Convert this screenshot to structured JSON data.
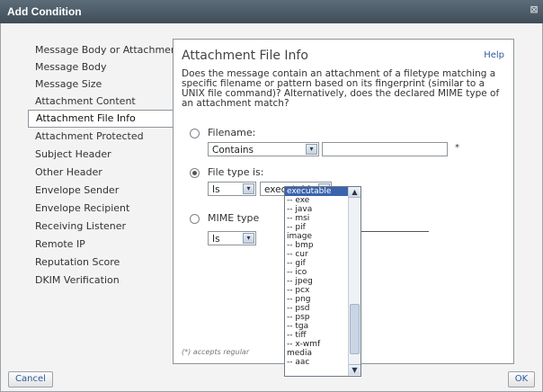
{
  "window": {
    "title": "Add Condition",
    "close_glyph": "⊠"
  },
  "sidebar": {
    "items": [
      {
        "label": "Message Body or Attachment"
      },
      {
        "label": "Message Body"
      },
      {
        "label": "Message Size"
      },
      {
        "label": "Attachment Content"
      },
      {
        "label": "Attachment File Info",
        "active": true
      },
      {
        "label": "Attachment Protected"
      },
      {
        "label": "Subject Header"
      },
      {
        "label": "Other Header"
      },
      {
        "label": "Envelope Sender"
      },
      {
        "label": "Envelope Recipient"
      },
      {
        "label": "Receiving Listener"
      },
      {
        "label": "Remote IP"
      },
      {
        "label": "Reputation Score"
      },
      {
        "label": "DKIM Verification"
      }
    ]
  },
  "panel": {
    "title": "Attachment File Info",
    "help": "Help",
    "description": "Does the message contain an attachment of a filetype matching a specific filename or pattern based on its fingerprint (similar to a UNIX file command)? Alternatively, does the declared MIME type of an attachment match?",
    "filename": {
      "label": "Filename:",
      "operator": "Contains",
      "value": "",
      "required_mark": "*"
    },
    "filetype": {
      "label": "File type is:",
      "operator": "Is",
      "value": "executable"
    },
    "mime": {
      "label": "MIME type",
      "operator": "Is"
    },
    "footnote": "(*) accepts regular"
  },
  "dropdown": {
    "options": [
      {
        "label": "executable",
        "selected": true
      },
      {
        "label": "-- exe"
      },
      {
        "label": "-- java"
      },
      {
        "label": "-- msi"
      },
      {
        "label": "-- pif"
      },
      {
        "label": "image"
      },
      {
        "label": "-- bmp"
      },
      {
        "label": "-- cur"
      },
      {
        "label": "-- gif"
      },
      {
        "label": "-- ico"
      },
      {
        "label": "-- jpeg"
      },
      {
        "label": "-- pcx"
      },
      {
        "label": "-- png"
      },
      {
        "label": "-- psd"
      },
      {
        "label": "-- psp"
      },
      {
        "label": "-- tga"
      },
      {
        "label": "-- tiff"
      },
      {
        "label": "-- x-wmf"
      },
      {
        "label": "media"
      },
      {
        "label": "-- aac"
      }
    ],
    "scroll_up": "▲",
    "scroll_down": "▼"
  },
  "footer": {
    "cancel": "Cancel",
    "ok": "OK"
  },
  "icons": {
    "select_arrow": "▾"
  }
}
